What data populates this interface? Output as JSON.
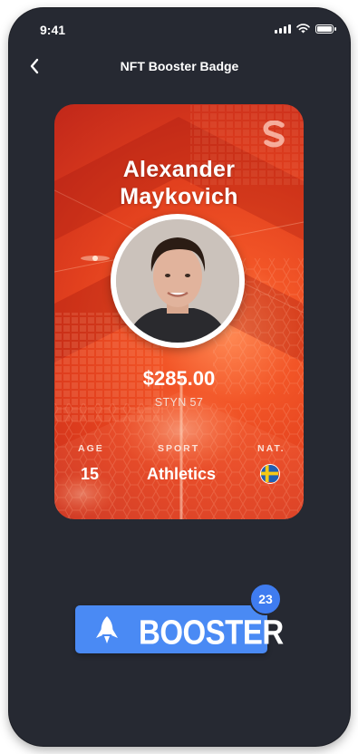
{
  "status_bar": {
    "time": "9:41"
  },
  "nav": {
    "title": "NFT Booster Badge",
    "back_icon": "chevron-left-icon"
  },
  "card": {
    "brand_icon": "stylized-s-logo-icon",
    "player_name_first": "Alexander",
    "player_name_last": "Maykovich",
    "price": "$285.00",
    "ticker": "STYN 57",
    "stats": {
      "age_label": "AGE",
      "age_value": "15",
      "sport_label": "SPORT",
      "sport_value": "Athletics",
      "nat_label": "NAT.",
      "nat_icon": "sweden-flag-icon"
    },
    "colors": {
      "primary": "#e2401e",
      "highlight": "#ff8a55"
    }
  },
  "booster": {
    "label": "BOOSTER",
    "count": "23",
    "icon": "rocket-icon",
    "color": "#4a8af4"
  }
}
